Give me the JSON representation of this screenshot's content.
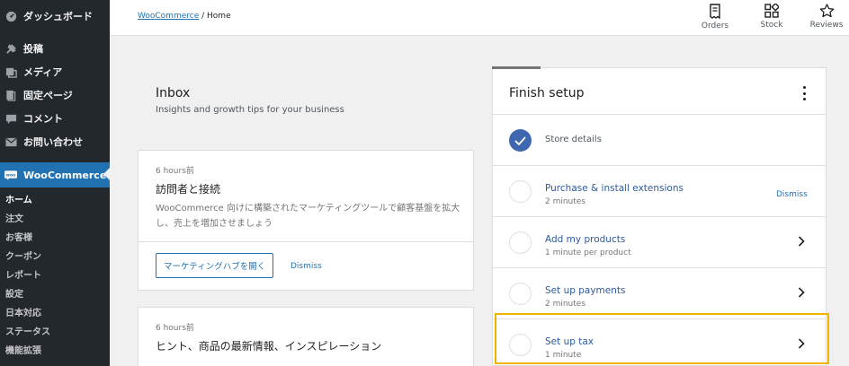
{
  "sidebar": {
    "items": [
      {
        "label": "ダッシュボード",
        "icon": "dashboard-icon"
      },
      {
        "label": "投稿",
        "icon": "pin-icon"
      },
      {
        "label": "メディア",
        "icon": "media-icon"
      },
      {
        "label": "固定ページ",
        "icon": "page-icon"
      },
      {
        "label": "コメント",
        "icon": "comment-icon"
      },
      {
        "label": "お問い合わせ",
        "icon": "mail-icon"
      },
      {
        "label": "WooCommerce",
        "icon": "woo-icon"
      }
    ],
    "woo_icon_text": "woo",
    "subitems": [
      "ホーム",
      "注文",
      "お客様",
      "クーポン",
      "レポート",
      "設定",
      "日本対応",
      "ステータス",
      "機能拡張"
    ]
  },
  "header": {
    "breadcrumb_link": "WooCommerce",
    "breadcrumb_sep": "/",
    "breadcrumb_current": "Home",
    "actions": [
      {
        "label": "Orders",
        "icon": "orders-icon"
      },
      {
        "label": "Stock",
        "icon": "stock-icon"
      },
      {
        "label": "Reviews",
        "icon": "reviews-icon"
      }
    ]
  },
  "inbox": {
    "title": "Inbox",
    "subtitle": "Insights and growth tips for your business",
    "cards": [
      {
        "time": "6 hours前",
        "title": "訪問者と接続",
        "body": "WooCommerce 向けに構築されたマーケティングツールで顧客基盤を拡大し、売上を増加させましょう",
        "button": "マーケティングハブを開く",
        "dismiss": "Dismiss"
      },
      {
        "time": "6 hours前",
        "title": "ヒント、商品の最新情報、インスピレーション"
      }
    ]
  },
  "setup": {
    "title": "Finish setup",
    "tasks": [
      {
        "title": "Store details",
        "done": true
      },
      {
        "title": "Purchase & install extensions",
        "subtitle": "2 minutes",
        "action": "Dismiss"
      },
      {
        "title": "Add my products",
        "subtitle": "1 minute per product"
      },
      {
        "title": "Set up payments",
        "subtitle": "2 minutes"
      },
      {
        "title": "Set up tax",
        "subtitle": "1 minute",
        "highlighted": true
      }
    ]
  },
  "colors": {
    "sidebar_bg": "#23282d",
    "accent": "#2271b1",
    "highlight": "#f0b400",
    "done_check": "#3f67b0"
  }
}
